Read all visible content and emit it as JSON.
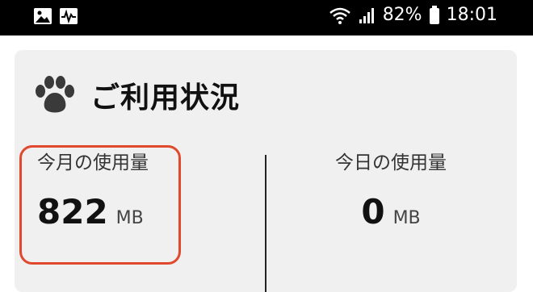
{
  "status_bar": {
    "battery_percent": "82%",
    "time": "18:01",
    "left_icons": [
      "image-icon",
      "activity-icon"
    ],
    "right_icons": [
      "wifi-icon",
      "signal-icon",
      "battery-icon"
    ]
  },
  "card": {
    "icon": "paw-icon",
    "title": "ご利用状況",
    "monthly": {
      "label": "今月の使用量",
      "value": "822",
      "unit": "MB"
    },
    "today": {
      "label": "今日の使用量",
      "value": "0",
      "unit": "MB"
    }
  },
  "colors": {
    "highlight": "#e0492d",
    "card_bg": "#f0f0f0",
    "status_bar_bg": "#000000"
  }
}
